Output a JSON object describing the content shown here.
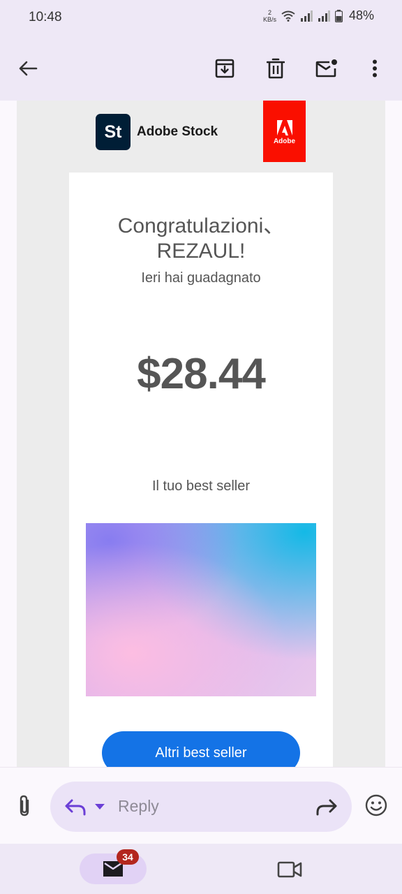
{
  "status_bar": {
    "time": "10:48",
    "net_speed_value": "2",
    "net_speed_unit": "KB/s",
    "battery": "48%"
  },
  "app_bar": {
    "back_icon": "arrow-back-icon",
    "archive_icon": "archive-icon",
    "delete_icon": "trash-icon",
    "mark_unread_icon": "mark-unread-icon",
    "more_icon": "more-vert-icon"
  },
  "email": {
    "brand_badge": "St",
    "brand_name": "Adobe Stock",
    "adobe_logo_text": "Adobe",
    "greeting_line1": "Congratulazioni、",
    "greeting_line2": "REZAUL!",
    "earned_label": "Ieri hai guadagnato",
    "amount": "$28.44",
    "bestseller_label": "Il tuo best seller",
    "cta_label": "Altri best seller"
  },
  "reply_bar": {
    "placeholder": "Reply",
    "attach_icon": "paperclip-icon",
    "reply_icon": "reply-icon",
    "dropdown_icon": "caret-down-icon",
    "forward_icon": "forward-icon",
    "emoji_icon": "emoji-icon"
  },
  "bottom_nav": {
    "mail_badge": "34",
    "mail_icon": "mail-icon",
    "meet_icon": "video-camera-icon"
  },
  "colors": {
    "app_bar_bg": "#eee8f6",
    "cta_blue": "#1473e6",
    "adobe_red": "#fa0f00",
    "badge_red": "#b3261e",
    "reply_accent": "#6b3fd6"
  }
}
